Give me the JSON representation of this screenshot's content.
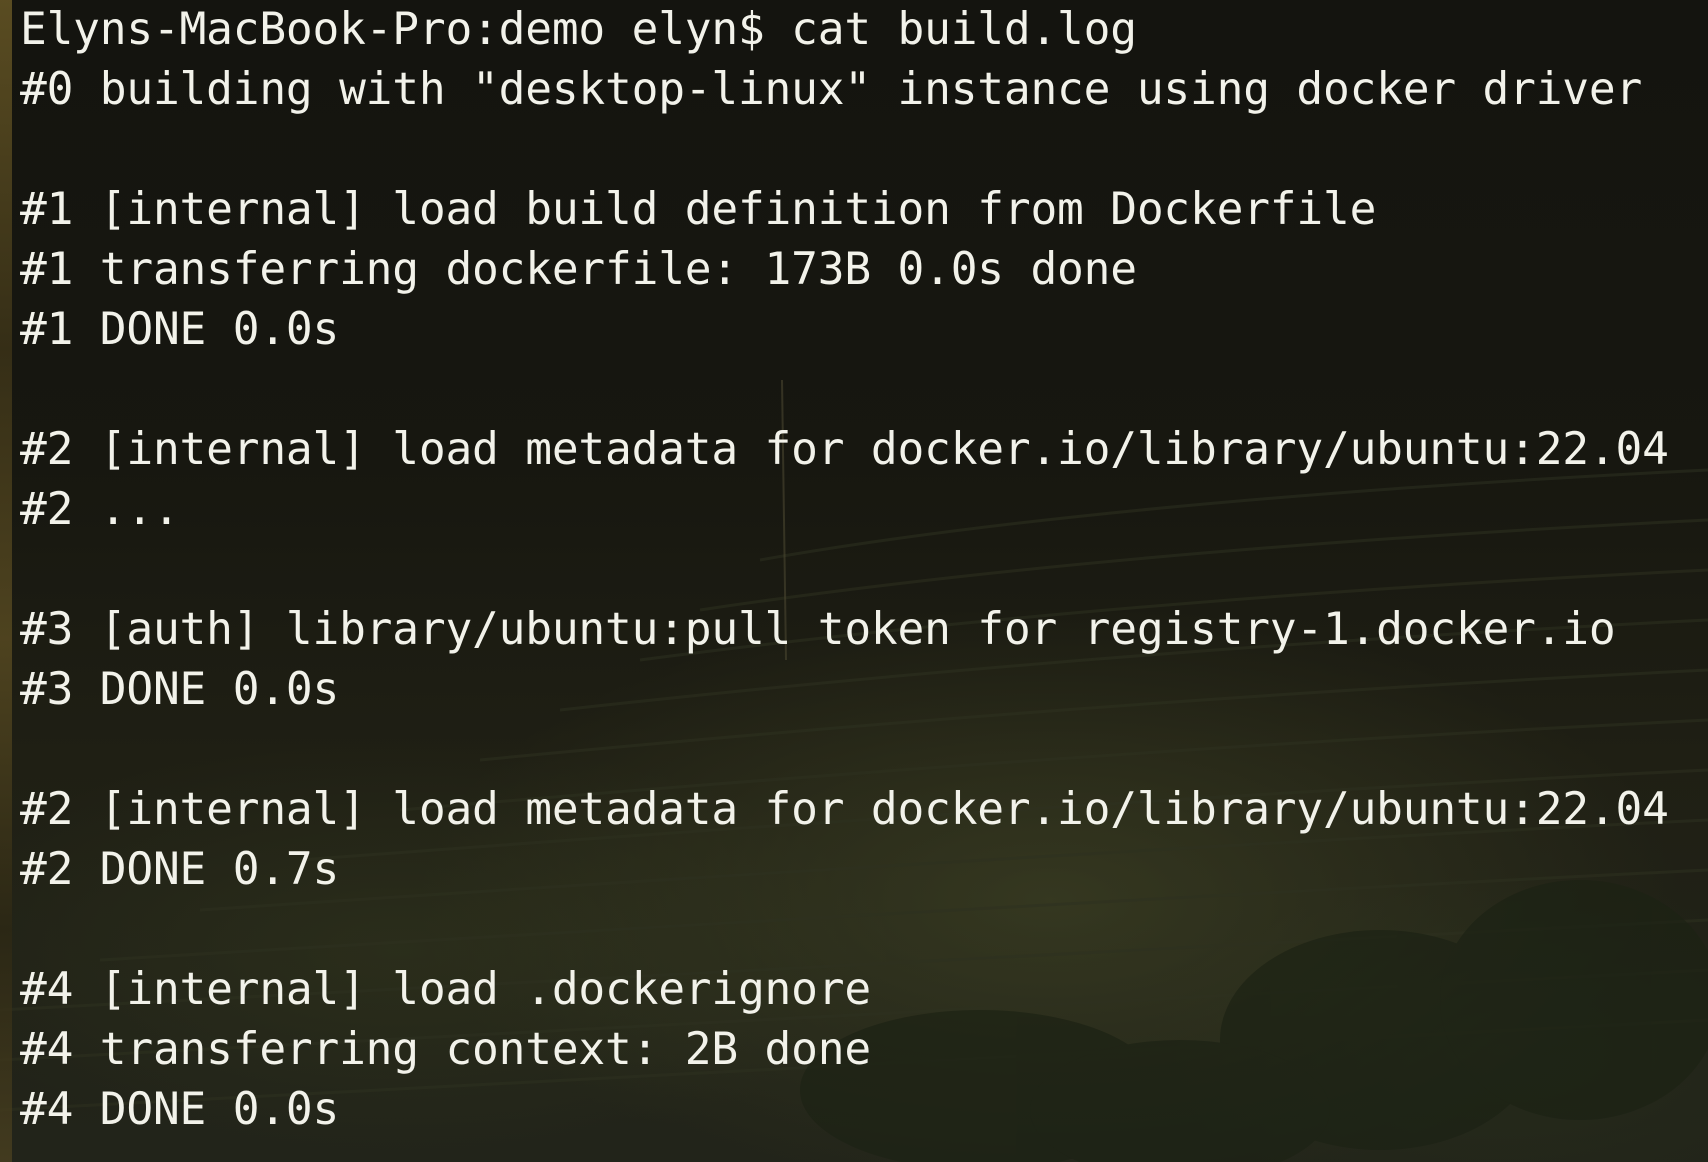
{
  "terminal": {
    "lines": [
      "Elyns-MacBook-Pro:demo elyn$ cat build.log",
      "#0 building with \"desktop-linux\" instance using docker driver",
      "",
      "#1 [internal] load build definition from Dockerfile",
      "#1 transferring dockerfile: 173B 0.0s done",
      "#1 DONE 0.0s",
      "",
      "#2 [internal] load metadata for docker.io/library/ubuntu:22.04",
      "#2 ...",
      "",
      "#3 [auth] library/ubuntu:pull token for registry-1.docker.io",
      "#3 DONE 0.0s",
      "",
      "#2 [internal] load metadata for docker.io/library/ubuntu:22.04",
      "#2 DONE 0.7s",
      "",
      "#4 [internal] load .dockerignore",
      "#4 transferring context: 2B done",
      "#4 DONE 0.0s"
    ]
  },
  "colors": {
    "text": "#f2f2ea",
    "background": "#1a1a14"
  }
}
